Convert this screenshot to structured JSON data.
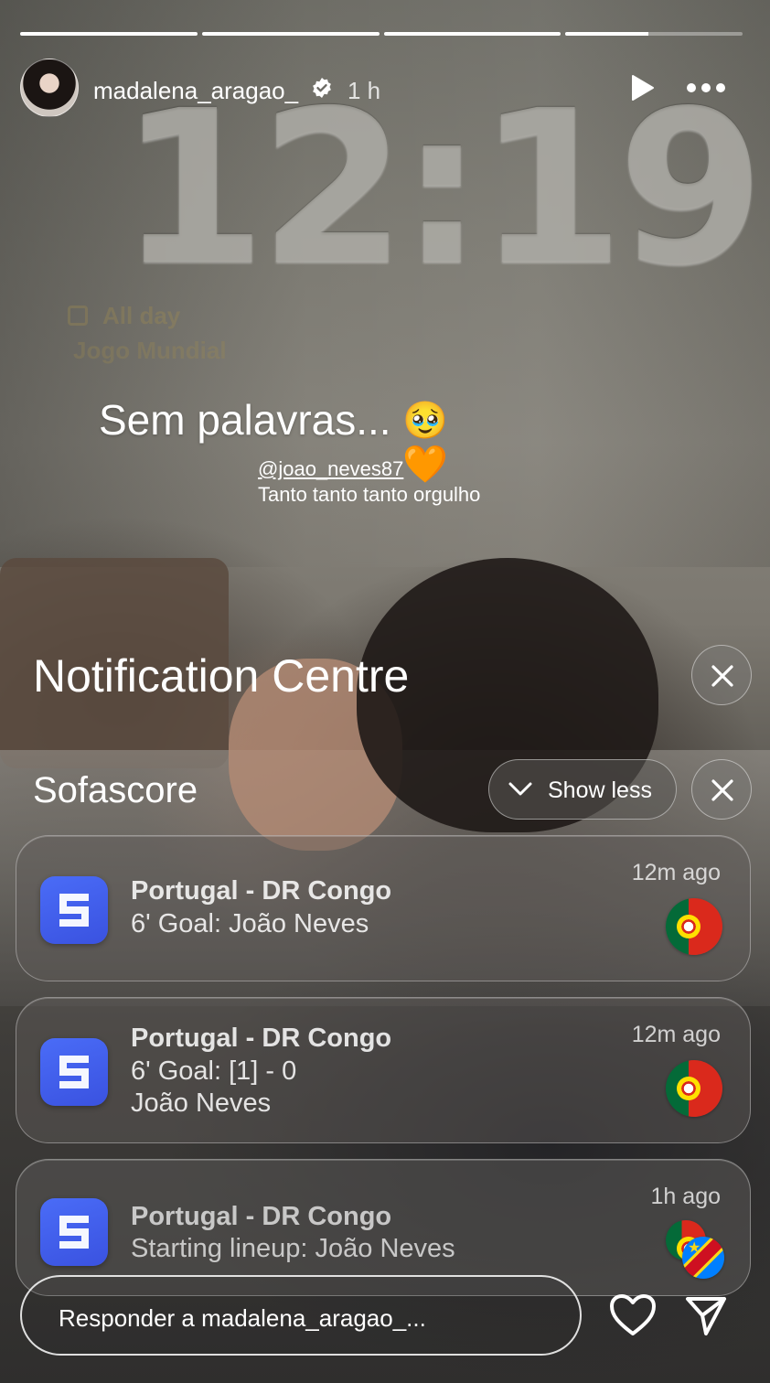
{
  "story": {
    "progress_segments": [
      1,
      1,
      1,
      0.47
    ],
    "user": {
      "username": "madalena_aragao_",
      "verified": true,
      "time_ago": "1 h"
    },
    "controls": {
      "play_icon": "play-icon",
      "more_icon": "more-horizontal-icon"
    }
  },
  "lockscreen": {
    "time": "12:19",
    "widget": {
      "icon": "calendar-icon",
      "all_day": "All day",
      "event": "Jogo Mundial"
    }
  },
  "caption": {
    "text": "Sem palavras...",
    "emoji": "🥹🧡",
    "mention": "@joao_neves87",
    "subtext": "Tanto tanto tanto orgulho"
  },
  "notification_centre": {
    "title": "Notification Centre",
    "close_icon": "close-icon",
    "group": {
      "app_name": "Sofascore",
      "show_less_label": "Show less",
      "notifications": [
        {
          "title": "Portugal - DR Congo",
          "lines": [
            "6' Goal: João Neves"
          ],
          "time": "12m ago",
          "flags": [
            "portugal-flag"
          ]
        },
        {
          "title": "Portugal - DR Congo",
          "lines": [
            "6' Goal: [1] - 0",
            "João Neves"
          ],
          "time": "12m ago",
          "flags": [
            "portugal-flag"
          ]
        },
        {
          "title": "Portugal - DR Congo",
          "lines": [
            "Starting lineup: João Neves"
          ],
          "time": "1h ago",
          "flags": [
            "portugal-flag",
            "dr-congo-flag"
          ]
        }
      ]
    }
  },
  "reply": {
    "placeholder": "Responder a madalena_aragao_...",
    "like_icon": "heart-icon",
    "send_icon": "send-icon"
  },
  "colors": {
    "sofascore_blue": "#3a52e0",
    "portugal_green": "#046a38",
    "portugal_red": "#da291c"
  }
}
